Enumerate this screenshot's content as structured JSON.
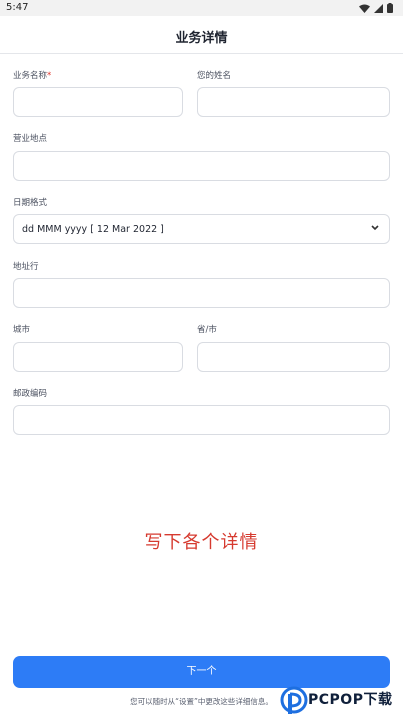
{
  "status_bar": {
    "time": "5:47"
  },
  "header": {
    "title": "业务详情"
  },
  "form": {
    "business_name": {
      "label": "业务名称",
      "required_mark": "*",
      "value": ""
    },
    "your_name": {
      "label": "您的姓名",
      "value": ""
    },
    "business_location": {
      "label": "营业地点",
      "value": ""
    },
    "date_format": {
      "label": "日期格式",
      "value": "dd MMM yyyy [ 12 Mar 2022 ]"
    },
    "address_line": {
      "label": "地址行",
      "value": ""
    },
    "city": {
      "label": "城市",
      "value": ""
    },
    "province": {
      "label": "省/市",
      "value": ""
    },
    "postal_code": {
      "label": "邮政编码",
      "value": ""
    }
  },
  "hint": "写下各个详情",
  "next_button": {
    "label": "下一个"
  },
  "footer_note": "您可以随时从“设置”中更改这些详细信息。",
  "watermark": {
    "text": "PCPOP下载"
  },
  "colors": {
    "accent": "#2d7cf6",
    "hint": "#d63a2f",
    "required": "#e0352b"
  }
}
